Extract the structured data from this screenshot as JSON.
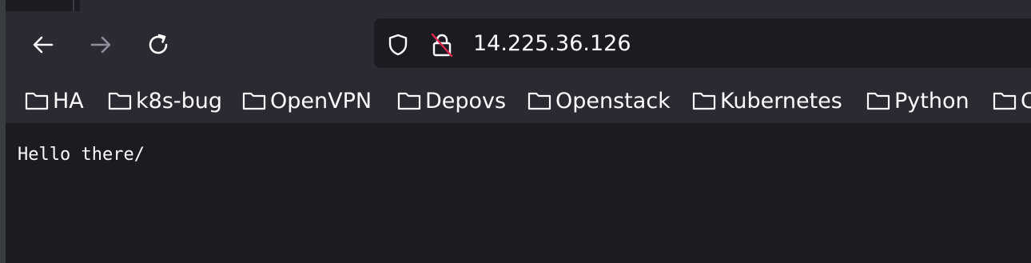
{
  "browser": {
    "url": "14.225.36.126",
    "nav": {
      "back_icon": "arrow-left-icon",
      "forward_icon": "arrow-right-icon",
      "reload_icon": "reload-icon"
    },
    "urlbar_icons": [
      "shield-icon",
      "insecure-lock-icon"
    ]
  },
  "bookmarks": {
    "items": [
      {
        "label": "HA"
      },
      {
        "label": "k8s-bug"
      },
      {
        "label": "OpenVPN"
      },
      {
        "label": "Depovs"
      },
      {
        "label": "Openstack"
      },
      {
        "label": "Kubernetes"
      },
      {
        "label": "Python"
      },
      {
        "label": "C"
      }
    ]
  },
  "page": {
    "body_text": "Hello there/"
  },
  "colors": {
    "toolbar": "#2b2a33",
    "content_bg": "#1c1b22",
    "text": "#fbfbfe",
    "disabled": "#8f8f9d",
    "insecure_slash": "#e22850"
  }
}
